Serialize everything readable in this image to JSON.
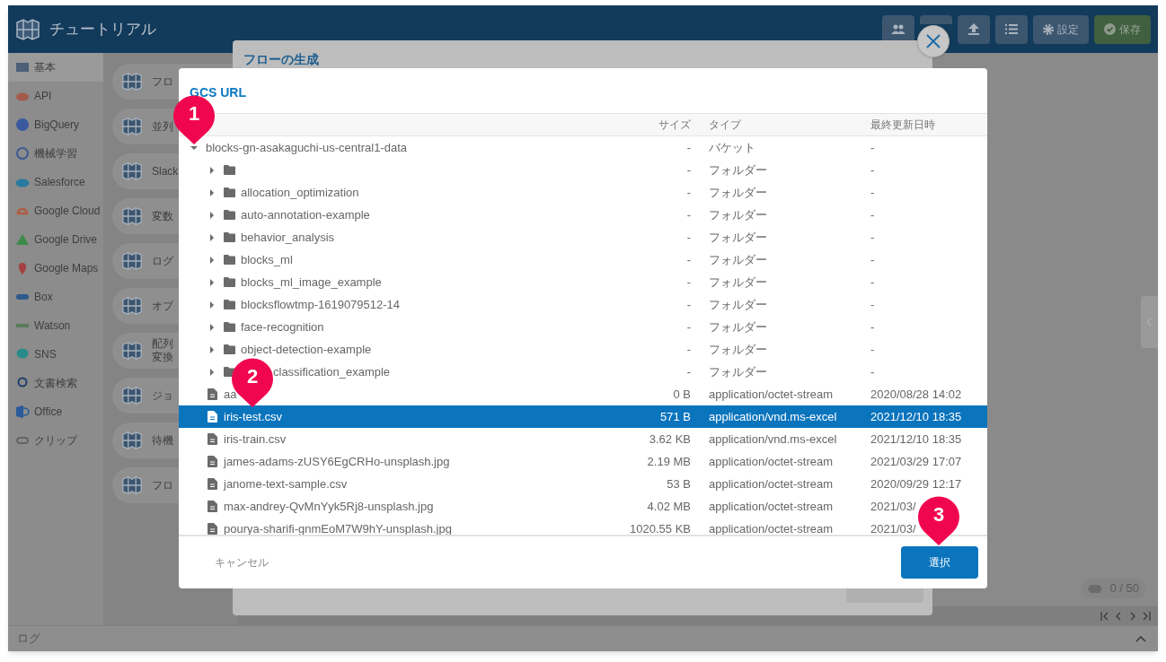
{
  "app": {
    "title": "チュートリアル",
    "settings": "設定",
    "save": "保存"
  },
  "sidebar": [
    {
      "label": "基本",
      "selected": true
    },
    {
      "label": "API",
      "selected": false
    },
    {
      "label": "BigQuery",
      "selected": false
    },
    {
      "label": "機械学習",
      "selected": false
    },
    {
      "label": "Salesforce",
      "selected": false
    },
    {
      "label": "Google Cloud",
      "selected": false
    },
    {
      "label": "Google Drive",
      "selected": false
    },
    {
      "label": "Google Maps",
      "selected": false
    },
    {
      "label": "Box",
      "selected": false
    },
    {
      "label": "Watson",
      "selected": false
    },
    {
      "label": "SNS",
      "selected": false
    },
    {
      "label": "文書検索",
      "selected": false
    },
    {
      "label": "Office",
      "selected": false
    },
    {
      "label": "クリップ",
      "selected": false
    }
  ],
  "blocks": [
    {
      "lines": [
        "フロ"
      ]
    },
    {
      "lines": [
        "並列"
      ]
    },
    {
      "lines": [
        "Slack"
      ]
    },
    {
      "lines": [
        "変数"
      ]
    },
    {
      "lines": [
        "ログ"
      ]
    },
    {
      "lines": [
        "オブ"
      ]
    },
    {
      "lines": [
        "配列",
        "変換"
      ]
    },
    {
      "lines": [
        "ジョ"
      ]
    },
    {
      "lines": [
        "待機"
      ]
    },
    {
      "lines": [
        "フロ"
      ]
    }
  ],
  "background_dialog": {
    "title": "フローの生成"
  },
  "dialog": {
    "title": "GCS URL",
    "columns": [
      "サイズ",
      "タイプ",
      "最終更新日時"
    ],
    "tree": [
      {
        "kind": "bucket",
        "name": "blocks-gn-asakaguchi-us-central1-data",
        "size": "-",
        "type": "バケット",
        "modified": "-",
        "expanded": true,
        "selected": false,
        "children": [
          {
            "kind": "folder",
            "size": "-",
            "type": "フォルダー",
            "modified": "-",
            "expanded": false,
            "selected": false
          },
          {
            "kind": "folder",
            "name": "allocation_optimization",
            "size": "-",
            "type": "フォルダー",
            "modified": "-",
            "expanded": false,
            "selected": false
          },
          {
            "kind": "folder",
            "name": "auto-annotation-example",
            "size": "-",
            "type": "フォルダー",
            "modified": "-",
            "expanded": false,
            "selected": false
          },
          {
            "kind": "folder",
            "name": "behavior_analysis",
            "size": "-",
            "type": "フォルダー",
            "modified": "-",
            "expanded": false,
            "selected": false
          },
          {
            "kind": "folder",
            "name": "blocks_ml",
            "size": "-",
            "type": "フォルダー",
            "modified": "-",
            "expanded": false,
            "selected": false
          },
          {
            "kind": "folder",
            "name": "blocks_ml_image_example",
            "size": "-",
            "type": "フォルダー",
            "modified": "-",
            "expanded": false,
            "selected": false
          },
          {
            "kind": "folder",
            "name": "blocksflowtmp-1619079512-14",
            "size": "-",
            "type": "フォルダー",
            "modified": "-",
            "expanded": false,
            "selected": false
          },
          {
            "kind": "folder",
            "name": "face-recognition",
            "size": "-",
            "type": "フォルダー",
            "modified": "-",
            "expanded": false,
            "selected": false
          },
          {
            "kind": "folder",
            "name": "object-detection-example",
            "size": "-",
            "type": "フォルダー",
            "modified": "-",
            "expanded": false,
            "selected": false
          },
          {
            "kind": "folder",
            "name": "classification_example",
            "covered": true,
            "size": "-",
            "type": "フォルダー",
            "modified": "-",
            "expanded": false,
            "selected": false
          },
          {
            "kind": "file",
            "name": "aa",
            "covered": false,
            "size": "0 B",
            "type": "application/octet-stream",
            "modified": "2020/08/28 14:02",
            "selected": false
          },
          {
            "kind": "file",
            "name": "iris-test.csv",
            "size": "571 B",
            "type": "application/vnd.ms-excel",
            "modified": "2021/12/10 18:35",
            "selected": true
          },
          {
            "kind": "file",
            "name": "iris-train.csv",
            "size": "3.62 KB",
            "type": "application/vnd.ms-excel",
            "modified": "2021/12/10 18:35",
            "selected": false
          },
          {
            "kind": "file",
            "name": "james-adams-zUSY6EgCRHo-unsplash.jpg",
            "size": "2.19 MB",
            "type": "application/octet-stream",
            "modified": "2021/03/29 17:07",
            "selected": false
          },
          {
            "kind": "file",
            "name": "janome-text-sample.csv",
            "size": "53 B",
            "type": "application/octet-stream",
            "modified": "2020/09/29 12:17",
            "selected": false
          },
          {
            "kind": "file",
            "name": "max-andrey-QvMnYyk5Rj8-unsplash.jpg",
            "size": "4.02 MB",
            "type": "application/octet-stream",
            "modified": "2021/03/",
            "selected": false
          },
          {
            "kind": "file",
            "name": "pourya-sharifi-gnmEoM7W9hY-unsplash.jpg",
            "size": "1020.55 KB",
            "type": "application/octet-stream",
            "modified": "2021/03/",
            "selected": false
          }
        ]
      }
    ],
    "cancel": "キャンセル",
    "select": "選択"
  },
  "markers": [
    "1",
    "2",
    "3"
  ],
  "counter": "0 / 50",
  "log_bar": "ログ"
}
